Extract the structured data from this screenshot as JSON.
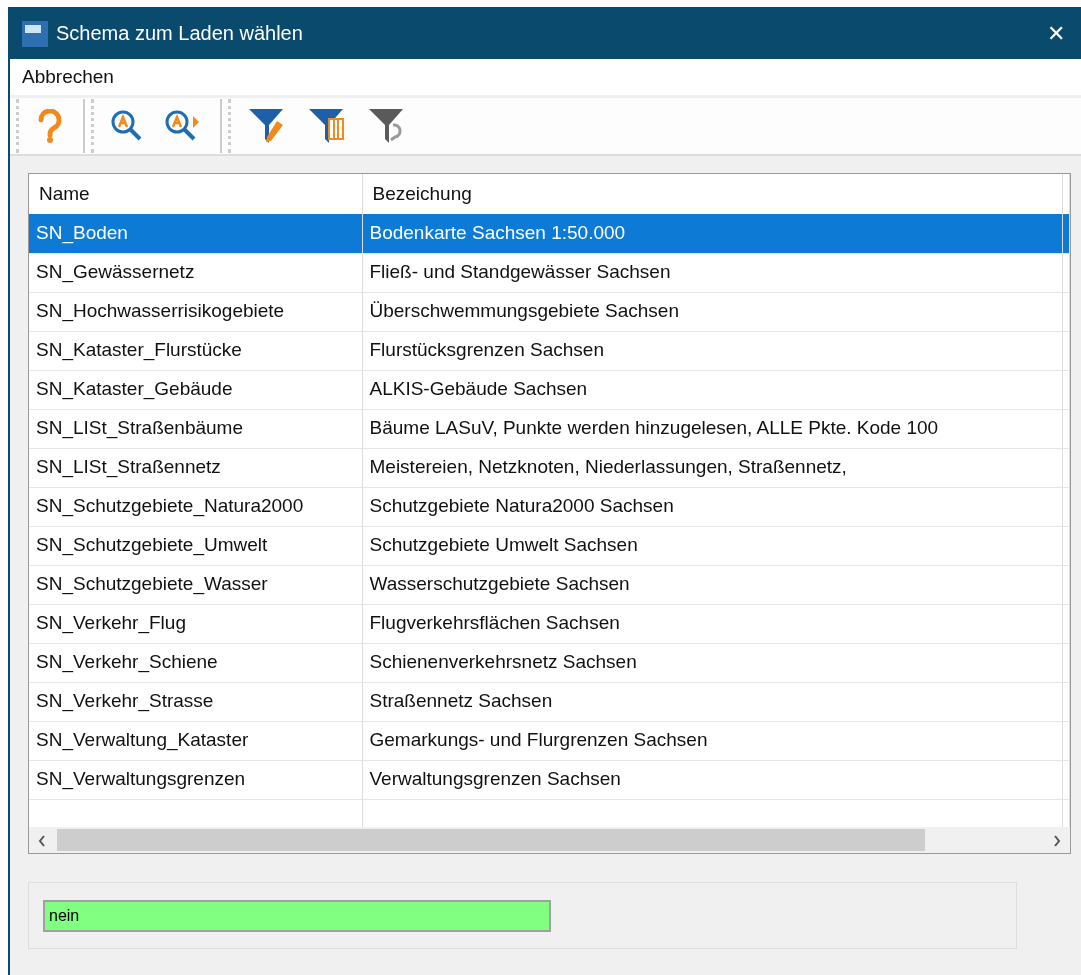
{
  "window": {
    "title": "Schema zum Laden wählen",
    "close": "✕"
  },
  "menu": [
    {
      "label": "Abbrechen"
    }
  ],
  "toolbar": [
    {
      "kind": "help"
    },
    {
      "kind": "separator"
    },
    {
      "kind": "zoom"
    },
    {
      "kind": "zoom-next"
    },
    {
      "kind": "separator"
    },
    {
      "kind": "filter-edit"
    },
    {
      "kind": "filter-columns"
    },
    {
      "kind": "filter-reset"
    }
  ],
  "table": {
    "columns": [
      "Name",
      "Bezeichung"
    ],
    "rows": [
      {
        "name": "SN_Boden",
        "description": "Bodenkarte Sachsen 1:50.000",
        "selected": true
      },
      {
        "name": "SN_Gewässernetz",
        "description": "Fließ- und Standgewässer Sachsen",
        "selected": false
      },
      {
        "name": "SN_Hochwasserrisikogebiete",
        "description": "Überschwemmungsgebiete Sachsen",
        "selected": false
      },
      {
        "name": "SN_Kataster_Flurstücke",
        "description": "Flurstücksgrenzen Sachsen",
        "selected": false
      },
      {
        "name": "SN_Kataster_Gebäude",
        "description": "ALKIS-Gebäude Sachsen",
        "selected": false
      },
      {
        "name": "SN_LISt_Straßenbäume",
        "description": "Bäume LASuV, Punkte werden hinzugelesen, ALLE Pkte. Kode 100",
        "selected": false
      },
      {
        "name": "SN_LISt_Straßennetz",
        "description": "Meistereien, Netzknoten, Niederlassungen, Straßennetz,",
        "selected": false
      },
      {
        "name": "SN_Schutzgebiete_Natura2000",
        "description": "Schutzgebiete Natura2000 Sachsen",
        "selected": false
      },
      {
        "name": "SN_Schutzgebiete_Umwelt",
        "description": "Schutzgebiete Umwelt Sachsen",
        "selected": false
      },
      {
        "name": "SN_Schutzgebiete_Wasser",
        "description": "Wasserschutzgebiete Sachsen",
        "selected": false
      },
      {
        "name": "SN_Verkehr_Flug",
        "description": "Flugverkehrsflächen Sachsen",
        "selected": false
      },
      {
        "name": "SN_Verkehr_Schiene",
        "description": "Schienenverkehrsnetz Sachsen",
        "selected": false
      },
      {
        "name": "SN_Verkehr_Strasse",
        "description": "Straßennetz Sachsen",
        "selected": false
      },
      {
        "name": "SN_Verwaltung_Kataster",
        "description": "Gemarkungs- und Flurgrenzen Sachsen",
        "selected": false
      },
      {
        "name": "SN_Verwaltungsgrenzen",
        "description": "Verwaltungsgrenzen Sachsen",
        "selected": false
      }
    ]
  },
  "status_field": {
    "value": "nein"
  }
}
